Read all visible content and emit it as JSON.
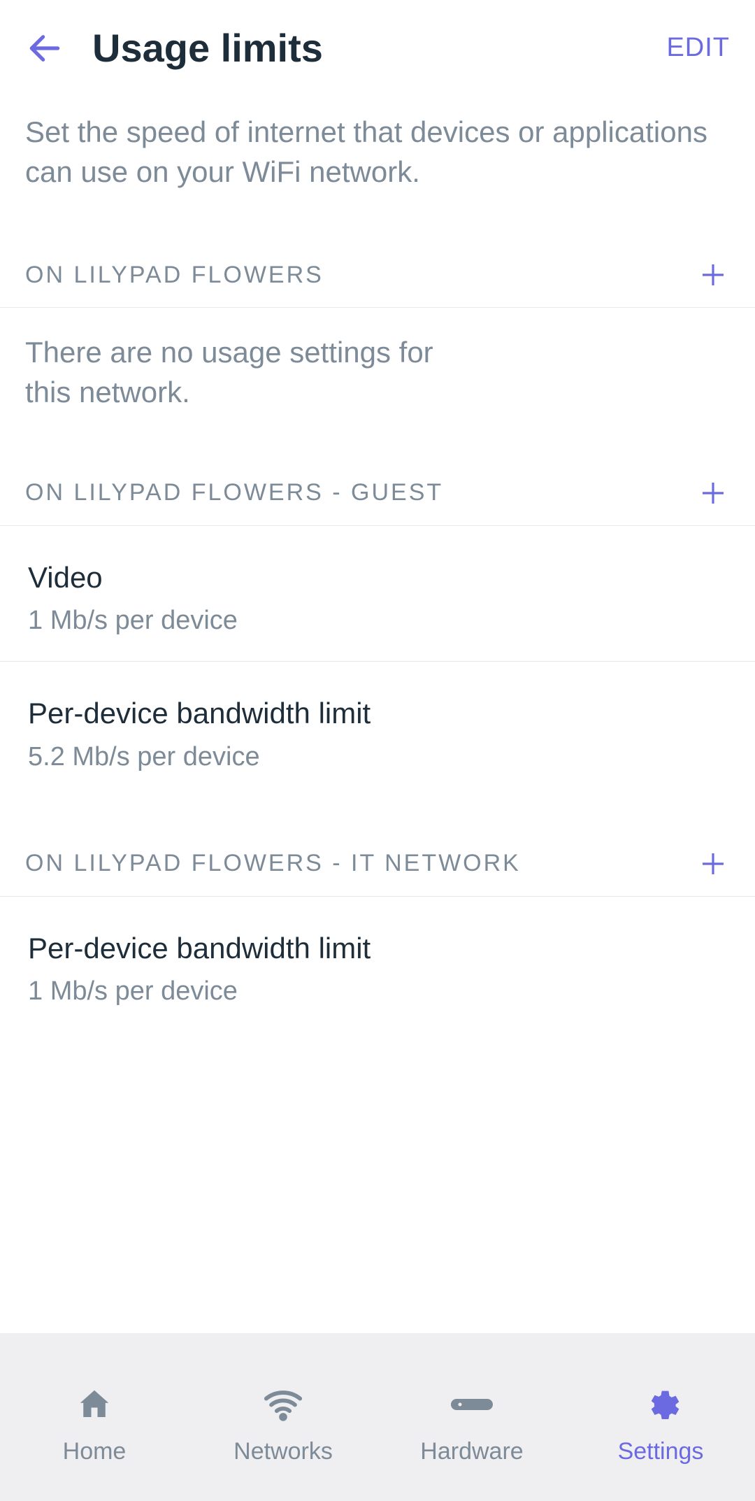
{
  "header": {
    "title": "Usage limits",
    "editLabel": "EDIT"
  },
  "description": "Set the speed of internet that devices or applications can use on your WiFi network.",
  "sections": [
    {
      "label": "ON LILYPAD FLOWERS",
      "emptyMessage": "There are no usage settings for this network.",
      "items": []
    },
    {
      "label": "ON LILYPAD FLOWERS - GUEST",
      "items": [
        {
          "title": "Video",
          "sub": "1 Mb/s per device"
        },
        {
          "title": "Per-device bandwidth limit",
          "sub": "5.2 Mb/s per device"
        }
      ]
    },
    {
      "label": "ON LILYPAD FLOWERS - IT NETWORK",
      "items": [
        {
          "title": "Per-device bandwidth limit",
          "sub": "1 Mb/s per device"
        }
      ]
    }
  ],
  "nav": {
    "items": [
      {
        "label": "Home",
        "icon": "home"
      },
      {
        "label": "Networks",
        "icon": "wifi"
      },
      {
        "label": "Hardware",
        "icon": "hardware"
      },
      {
        "label": "Settings",
        "icon": "gear"
      }
    ],
    "activeIndex": 3
  },
  "colors": {
    "accent": "#6b6ae0",
    "textMuted": "#7d8a97",
    "textDark": "#1e2d3a"
  }
}
